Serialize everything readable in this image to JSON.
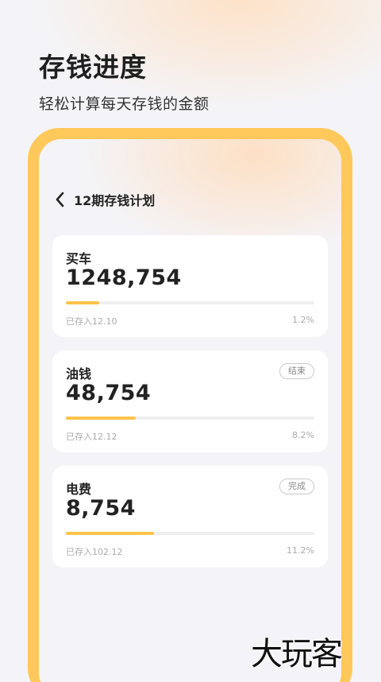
{
  "header": {
    "title": "存钱进度",
    "subtitle": "轻松计算每天存钱的金额"
  },
  "screen": {
    "nav_title": "12期存钱计划",
    "plans": [
      {
        "name": "买车",
        "amount": "1248,754",
        "badge": "",
        "note": "已存入12.10",
        "percent_label": "1.2%",
        "progress": 0.135
      },
      {
        "name": "油钱",
        "amount": "48,754",
        "badge": "结束",
        "note": "已存入12.12",
        "percent_label": "8.2%",
        "progress": 0.28
      },
      {
        "name": "电费",
        "amount": "8,754",
        "badge": "完成",
        "note": "已存入102.12",
        "percent_label": "11.2%",
        "progress": 0.355
      }
    ]
  },
  "watermark": "大玩客",
  "colors": {
    "accent": "#ffc34a",
    "frame": "#ffc85a"
  }
}
